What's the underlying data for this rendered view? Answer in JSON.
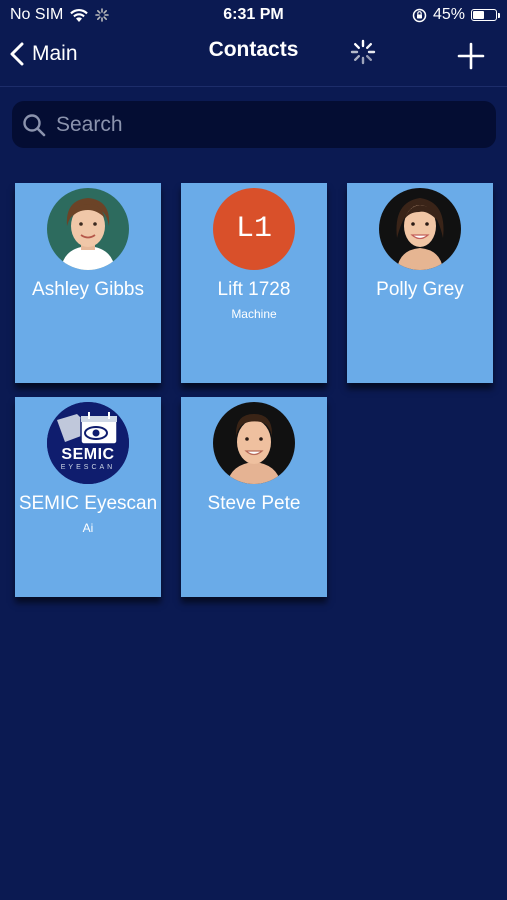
{
  "status_bar": {
    "carrier": "No SIM",
    "time": "6:31 PM",
    "battery_percent": "45%",
    "battery_level": 0.45
  },
  "nav": {
    "back_label": "Main",
    "title": "Contacts"
  },
  "search": {
    "placeholder": "Search",
    "value": ""
  },
  "contacts": [
    {
      "name": "Ashley Gibbs",
      "subtitle": "",
      "avatar": "photo-woman-brown-hair"
    },
    {
      "name": "Lift 1728",
      "subtitle": "Machine",
      "avatar_initials": "L1",
      "avatar_color": "#d9502a"
    },
    {
      "name": "Polly Grey",
      "subtitle": "",
      "avatar": "photo-woman-dark-hair"
    },
    {
      "name": "SEMIC Eyescan",
      "subtitle": "Ai",
      "logo_text": "SEMIC",
      "logo_subtext": "EYESCAN"
    },
    {
      "name": "Steve Pete",
      "subtitle": "",
      "avatar": "photo-man-dark-hair"
    }
  ],
  "colors": {
    "background": "#0b1a52",
    "card": "#6aabe8",
    "search_bg": "#040d33"
  }
}
